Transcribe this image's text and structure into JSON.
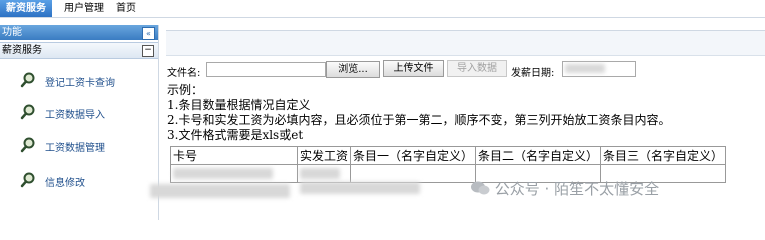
{
  "topbar": {
    "tabs": [
      "薪资服务",
      "用户管理",
      "首页"
    ]
  },
  "sidebar": {
    "header_label": "功能",
    "collapse_glyph": "«",
    "section_label": "薪资服务",
    "section_toggle": "−",
    "items": [
      {
        "label": "登记工资卡查询"
      },
      {
        "label": "工资数据导入"
      },
      {
        "label": "工资数据管理"
      },
      {
        "label": "信息修改"
      }
    ]
  },
  "form": {
    "file_label": "文件名:",
    "browse_label": "浏览...",
    "upload_label": "上传文件",
    "import_label": "导入数据",
    "date_label": "发薪日期:"
  },
  "instructions": {
    "heading": "示例：",
    "lines": [
      "1.条目数量根据情况自定义",
      "2.卡号和实发工资为必填内容，且必须位于第一第二，顺序不变，第三列开始放工资条目内容。",
      "3.文件格式需要是xls或et"
    ]
  },
  "table": {
    "headers": [
      "卡号",
      "实发工资",
      "条目一（名字自定义）",
      "条目二（名字自定义）",
      "条目三（名字自定义）"
    ]
  },
  "watermark": "公众号 · 陌笙不太懂安全"
}
